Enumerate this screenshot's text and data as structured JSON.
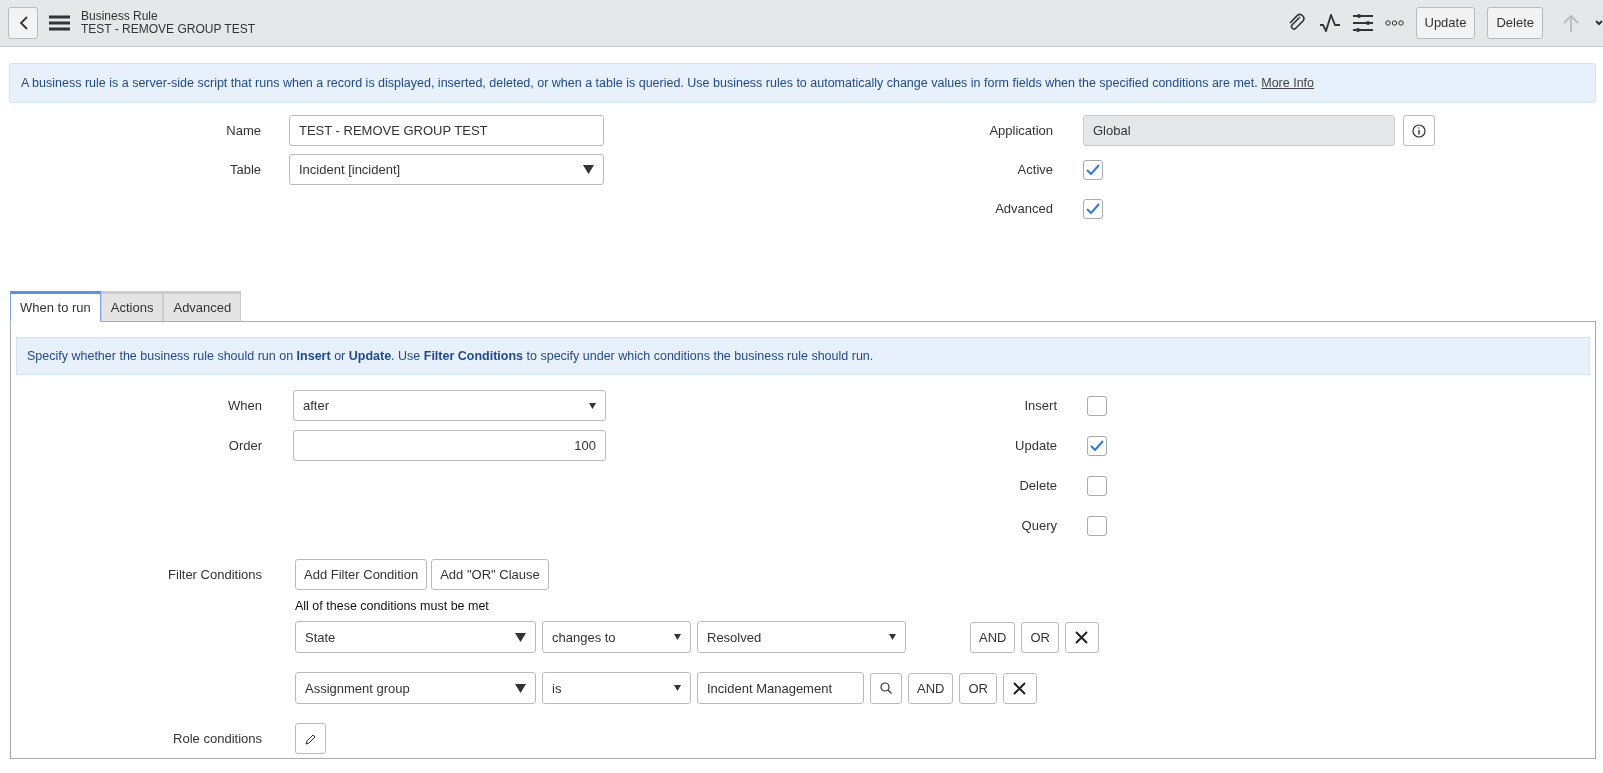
{
  "header": {
    "title": "Business Rule",
    "subtitle": "TEST - REMOVE GROUP TEST",
    "buttons": [
      "Update",
      "Delete"
    ]
  },
  "info": {
    "text": "A business rule is a server-side script that runs when a record is displayed, inserted, deleted, or when a table is queried. Use business rules to automatically change values in form fields when the specified conditions are met.",
    "link": "More Info"
  },
  "fields_left": [
    {
      "label": "Name",
      "kind": "text",
      "value": "TEST - REMOVE GROUP TEST"
    },
    {
      "label": "Table",
      "kind": "select",
      "value": "Incident [incident]"
    }
  ],
  "fields_right": [
    {
      "label": "Application",
      "kind": "readonly",
      "value": "Global"
    },
    {
      "label": "Active",
      "kind": "checkbox",
      "checked": true
    },
    {
      "label": "Advanced",
      "kind": "checkbox",
      "checked": true
    }
  ],
  "tabs": [
    {
      "label": "When to run",
      "selected": true
    },
    {
      "label": "Actions",
      "selected": false
    },
    {
      "label": "Advanced",
      "selected": false
    }
  ],
  "when_panel": {
    "hint": "Specify whether the business rule should run on **Insert** or **Update**. Use **Filter Conditions** to specify under which conditions the business rule should run.",
    "fields_left": [
      {
        "label": "When",
        "kind": "select",
        "value": "after"
      },
      {
        "label": "Order",
        "kind": "number",
        "value": "100"
      }
    ],
    "operations": [
      {
        "label": "Insert",
        "checked": false
      },
      {
        "label": "Update",
        "checked": true
      },
      {
        "label": "Delete",
        "checked": false
      },
      {
        "label": "Query",
        "checked": false
      }
    ],
    "filter": {
      "label": "Filter Conditions",
      "buttons": [
        "Add Filter Condition",
        "Add \"OR\" Clause"
      ],
      "note": "All of these conditions must be met",
      "conditions": [
        {
          "field": "State",
          "operator": "changes to",
          "value": "Resolved",
          "kind": "select",
          "and": "AND",
          "or": "OR"
        },
        {
          "field": "Assignment group",
          "operator": "is",
          "value": "Incident Management",
          "kind": "reference",
          "and": "AND",
          "or": "OR"
        }
      ]
    },
    "role_label": "Role conditions"
  }
}
